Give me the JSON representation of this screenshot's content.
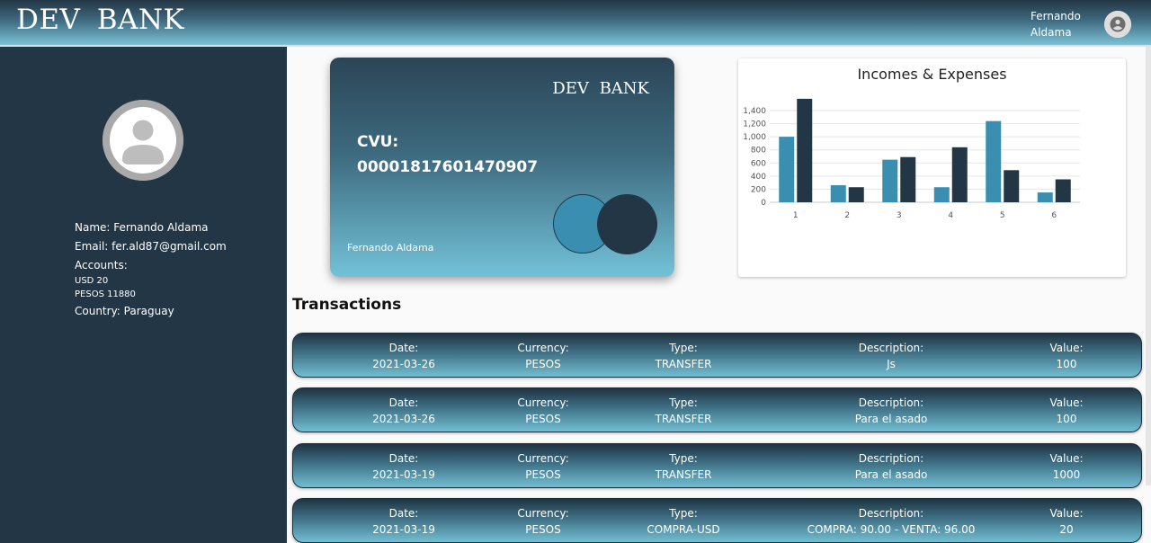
{
  "header": {
    "logo": "DEV  BANK",
    "user_first": "Fernando",
    "user_last": "Aldama",
    "avatar_icon": "account-circle-icon"
  },
  "sidebar": {
    "avatar_icon": "user-silhouette-icon",
    "name": "Name: Fernando Aldama",
    "email": "Email: fer.ald87@gmail.com",
    "accounts_label": "Accounts:",
    "accounts": [
      "USD 20",
      "PESOS 11880"
    ],
    "country": "Country: Paraguay"
  },
  "card": {
    "brand": "DEV  BANK",
    "cvu_label": "CVU:",
    "cvu": "00001817601470907",
    "holder": "Fernando Aldama"
  },
  "chart_data": {
    "type": "bar",
    "title": "Incomes & Expenses",
    "categories": [
      "1",
      "2",
      "3",
      "4",
      "5",
      "6"
    ],
    "series": [
      {
        "values": [
          1000,
          260,
          650,
          230,
          1240,
          150
        ],
        "color": "#3a8fb1"
      },
      {
        "values": [
          1580,
          230,
          690,
          840,
          490,
          350
        ],
        "color": "#233645"
      }
    ],
    "yticks": [
      "0",
      "200",
      "400",
      "600",
      "800",
      "1,000",
      "1,200",
      "1,400"
    ],
    "ylim": [
      0,
      1400
    ],
    "grid": true
  },
  "transactions": {
    "title": "Transactions",
    "headers": {
      "date": "Date:",
      "currency": "Currency:",
      "type": "Type:",
      "description": "Description:",
      "value": "Value:"
    },
    "rows": [
      {
        "date": "2021-03-26",
        "currency": "PESOS",
        "type": "TRANSFER",
        "description": "Js",
        "value": "100"
      },
      {
        "date": "2021-03-26",
        "currency": "PESOS",
        "type": "TRANSFER",
        "description": "Para el asado",
        "value": "100"
      },
      {
        "date": "2021-03-19",
        "currency": "PESOS",
        "type": "TRANSFER",
        "description": "Para el asado",
        "value": "1000"
      },
      {
        "date": "2021-03-19",
        "currency": "PESOS",
        "type": "COMPRA-USD",
        "description": "COMPRA: 90.00 - VENTA: 96.00",
        "value": "20"
      }
    ]
  }
}
